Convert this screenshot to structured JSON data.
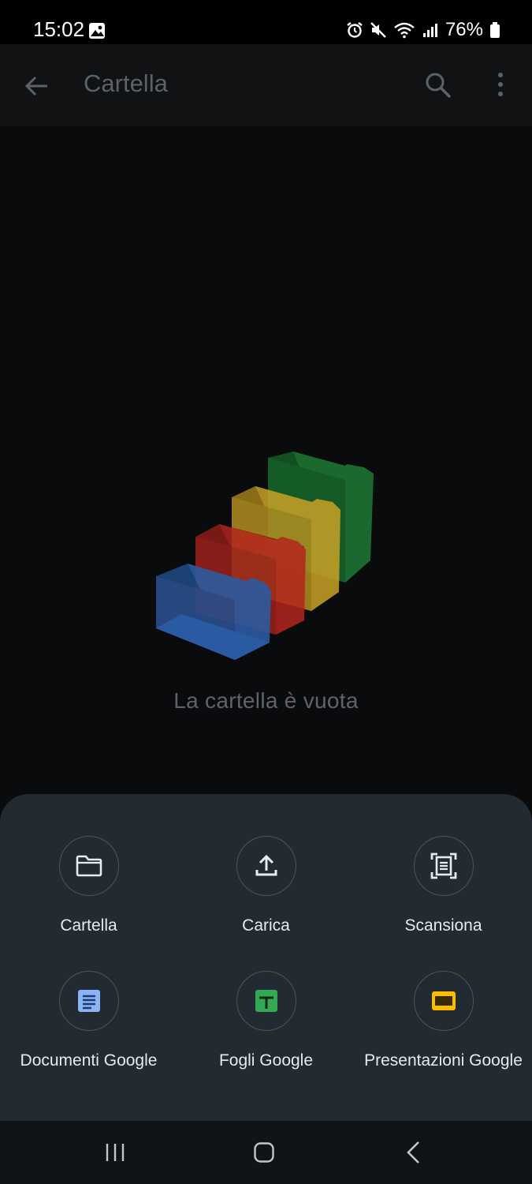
{
  "status_bar": {
    "time": "15:02",
    "battery": "76%",
    "icons": [
      "gallery-icon",
      "alarm-icon",
      "mute-icon",
      "wifi-icon",
      "signal-icon",
      "battery-icon"
    ]
  },
  "appbar": {
    "title": "Cartella",
    "back_icon": "arrow-back-icon",
    "search_icon": "search-icon",
    "more_icon": "more-vert-icon"
  },
  "empty_state": {
    "message": "La cartella è vuota"
  },
  "actions": [
    {
      "label": "Cartella",
      "icon": "folder-icon"
    },
    {
      "label": "Carica",
      "icon": "upload-icon"
    },
    {
      "label": "Scansiona",
      "icon": "scan-icon"
    },
    {
      "label": "Documenti Google",
      "icon": "google-docs-icon",
      "color": "#8ab4f8"
    },
    {
      "label": "Fogli Google",
      "icon": "google-sheets-icon",
      "color": "#34a853"
    },
    {
      "label": "Presentazioni Google",
      "icon": "google-slides-icon",
      "color": "#fbbc04"
    }
  ],
  "colors": {
    "sheet_background": "#222b31",
    "folder_blue": "#2c5aa0",
    "folder_red": "#b3261e",
    "folder_yellow": "#c9a227",
    "folder_green": "#1e7a35"
  }
}
